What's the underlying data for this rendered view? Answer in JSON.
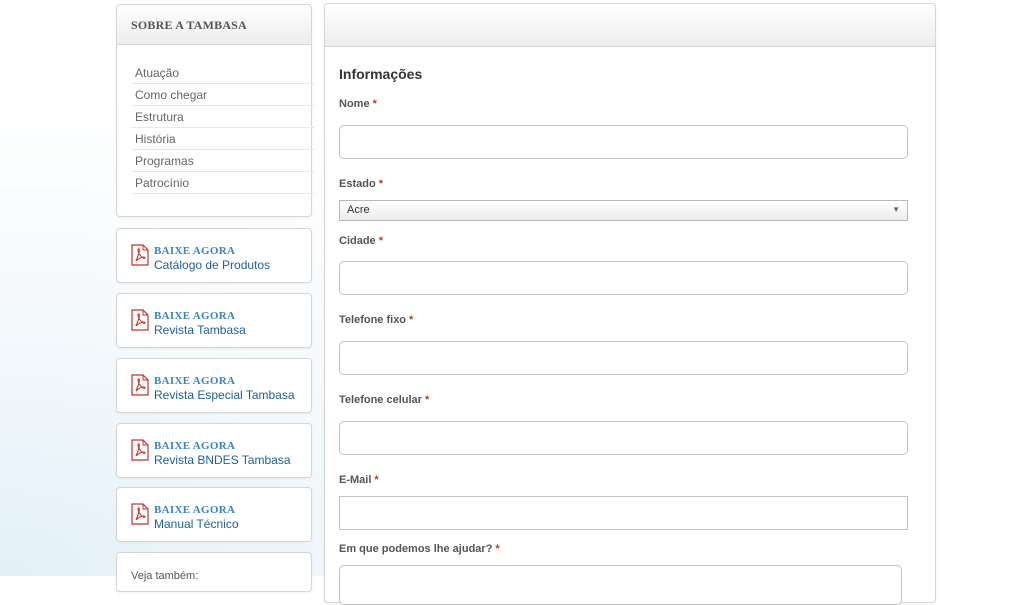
{
  "sidebar": {
    "about_title": "SOBRE A TAMBASA",
    "about_items": [
      {
        "label": "Atuação"
      },
      {
        "label": "Como chegar"
      },
      {
        "label": "Estrutura"
      },
      {
        "label": "História"
      },
      {
        "label": "Programas"
      },
      {
        "label": "Patrocínio"
      }
    ],
    "downloads": [
      {
        "cta": "BAIXE AGORA",
        "title": "Catálogo de Produtos"
      },
      {
        "cta": "BAIXE AGORA",
        "title": "Revista Tambasa"
      },
      {
        "cta": "BAIXE AGORA",
        "title": "Revista Especial Tambasa"
      },
      {
        "cta": "BAIXE AGORA",
        "title": "Revista BNDES Tambasa"
      },
      {
        "cta": "BAIXE AGORA",
        "title": "Manual Técnico"
      }
    ],
    "see_also": "Veja também:",
    "download_icon": "pdf-icon"
  },
  "form": {
    "section_title": "Informações",
    "required_mark": "*",
    "nome_label": "Nome",
    "nome_value": "",
    "estado_label": "Estado",
    "estado_value": "Acre",
    "cidade_label": "Cidade",
    "cidade_value": "",
    "telefone_fixo_label": "Telefone fixo",
    "telefone_fixo_value": "",
    "telefone_celular_label": "Telefone celular",
    "telefone_celular_value": "",
    "email_label": "E-Mail",
    "email_value": "",
    "ajuda_label": "Em que podemos lhe ajudar?",
    "ajuda_value": ""
  },
  "colors": {
    "link": "#1e5f9e",
    "cta": "#3d83c5",
    "required": "#c0392b",
    "pdf": "#c8302c"
  }
}
